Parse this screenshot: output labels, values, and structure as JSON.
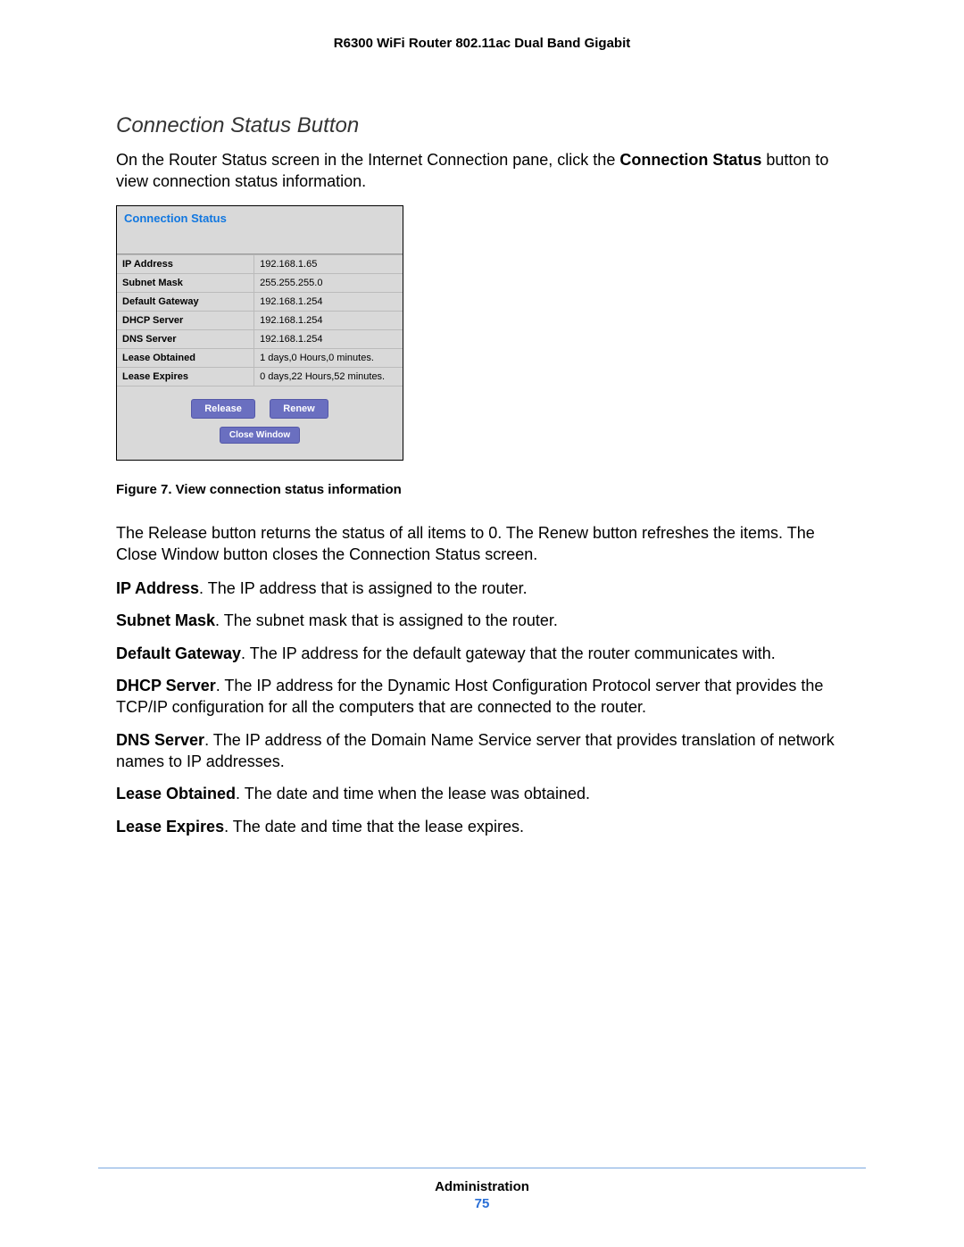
{
  "header": {
    "title": "R6300 WiFi Router 802.11ac Dual Band Gigabit"
  },
  "section": {
    "title": "Connection Status Button"
  },
  "intro": {
    "before": "On the Router Status screen in the Internet Connection pane, click the ",
    "bold": "Connection Status",
    "after": " button to view connection status information."
  },
  "dialog": {
    "title": "Connection Status",
    "rows": [
      {
        "label": "IP Address",
        "value": "192.168.1.65"
      },
      {
        "label": "Subnet Mask",
        "value": "255.255.255.0"
      },
      {
        "label": "Default Gateway",
        "value": "192.168.1.254"
      },
      {
        "label": "DHCP Server",
        "value": "192.168.1.254"
      },
      {
        "label": "DNS Server",
        "value": "192.168.1.254"
      },
      {
        "label": "Lease Obtained",
        "value": "1 days,0 Hours,0 minutes."
      },
      {
        "label": "Lease Expires",
        "value": "0 days,22 Hours,52 minutes."
      }
    ],
    "buttons": {
      "release": "Release",
      "renew": "Renew",
      "close": "Close Window"
    }
  },
  "figure_caption": "Figure 7. View connection status information",
  "paragraph_after_figure": "The Release button returns the status of all items to 0. The Renew button refreshes the items. The Close Window button closes the Connection Status screen.",
  "definitions": [
    {
      "term": "IP Address",
      "desc": ". The IP address that is assigned to the router."
    },
    {
      "term": "Subnet Mask",
      "desc": ". The subnet mask that is assigned to the router."
    },
    {
      "term": "Default Gateway",
      "desc": ". The IP address for the default gateway that the router communicates with."
    },
    {
      "term": "DHCP Server",
      "desc": ". The IP address for the Dynamic Host Configuration Protocol server that provides the TCP/IP configuration for all the computers that are connected to the router."
    },
    {
      "term": "DNS Server",
      "desc": ". The IP address of the Domain Name Service server that provides translation of network names to IP addresses."
    },
    {
      "term": "Lease Obtained",
      "desc": ". The date and time when the lease was obtained."
    },
    {
      "term": "Lease Expires",
      "desc": ". The date and time that the lease expires."
    }
  ],
  "footer": {
    "section": "Administration",
    "page": "75"
  }
}
